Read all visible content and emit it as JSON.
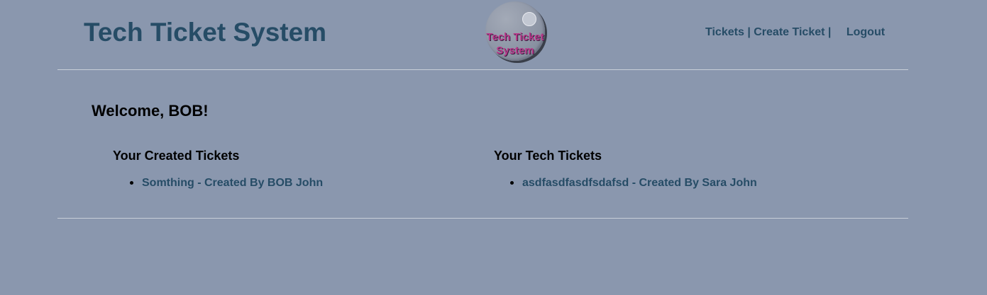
{
  "header": {
    "title": "Tech Ticket System",
    "logo_text_line1": "Tech Ticket",
    "logo_text_line2": "System",
    "nav": {
      "tickets": "Tickets",
      "separator": "|",
      "create_ticket": "Create Ticket",
      "logout": "Logout"
    }
  },
  "main": {
    "welcome": "Welcome, BOB!",
    "created_tickets": {
      "heading": "Your Created Tickets",
      "items": [
        {
          "label": "Somthing - Created By BOB John"
        }
      ]
    },
    "tech_tickets": {
      "heading": "Your Tech Tickets",
      "items": [
        {
          "label": "asdfasdfasdfsdafsd - Created By Sara John"
        }
      ]
    }
  },
  "colors": {
    "background": "#8a97ae",
    "heading_blue": "#264c66",
    "logo_text": "#b8388a",
    "divider": "#c9cfd9"
  }
}
